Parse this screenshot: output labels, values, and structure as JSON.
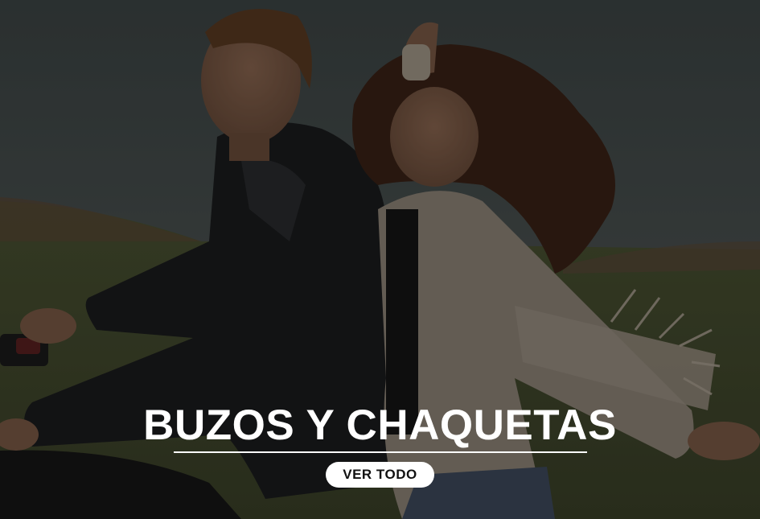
{
  "banner": {
    "title": "BUZOS Y CHAQUETAS",
    "cta_label": "VER TODO",
    "photo": "couple-on-motorbike-photo"
  },
  "colors": {
    "text": "#ffffff",
    "button_bg": "#ffffff",
    "button_text": "#111111"
  }
}
